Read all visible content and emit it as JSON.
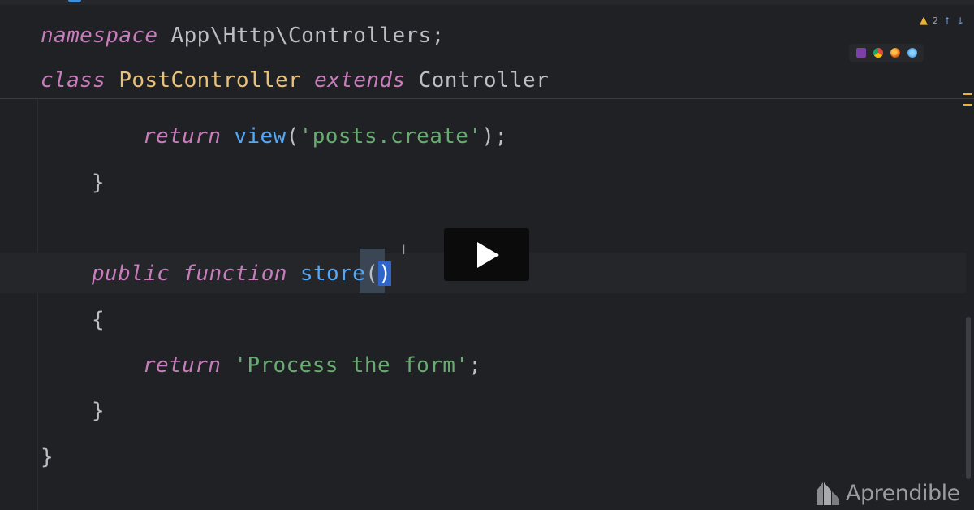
{
  "editor": {
    "sticky_header": {
      "namespace_keyword": "namespace",
      "namespace_value": "App\\Http\\Controllers;",
      "class_keyword": "class",
      "class_name": "PostController",
      "extends_keyword": "extends",
      "parent_class": "Controller"
    },
    "lines": {
      "create_return_keyword": "return",
      "create_view_fn": "view",
      "create_open_paren": "(",
      "create_view_arg": "'posts.create'",
      "create_close": ");",
      "create_close_brace": "}",
      "store_public": "public",
      "store_function": "function",
      "store_name": "store",
      "store_open_paren": "(",
      "store_close_paren": ")",
      "store_open_brace": "{",
      "store_return_keyword": "return",
      "store_return_value": "'Process the form'",
      "store_semicolon": ";",
      "store_close_brace": "}",
      "class_close_brace": "}"
    },
    "inspection": {
      "warning_count": "2",
      "icon": "warning-icon"
    },
    "browser_icons": [
      "phpstorm-icon",
      "chrome-icon",
      "firefox-icon",
      "safari-icon"
    ]
  },
  "video": {
    "play_icon": "play-icon"
  },
  "watermark": {
    "brand": "Aprendible"
  },
  "colors": {
    "background": "#202124",
    "keyword": "#c77dbb",
    "class_name": "#e8c17a",
    "function": "#56a8f5",
    "string": "#6aab73",
    "selection": "#2f65ca"
  }
}
